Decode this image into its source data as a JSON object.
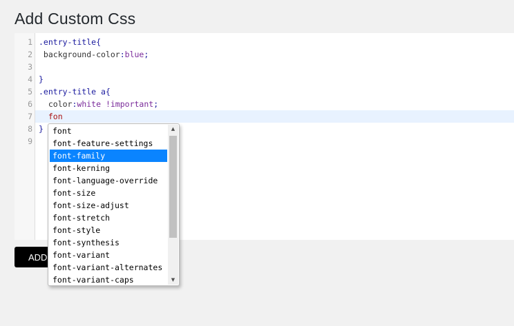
{
  "page": {
    "title": "Add Custom Css"
  },
  "editor": {
    "line_numbers": [
      "1",
      "2",
      "3",
      "4",
      "5",
      "6",
      "7",
      "8",
      "9"
    ],
    "lines": [
      {
        "parts": [
          {
            "text": ".entry-title{",
            "kind": "sel"
          }
        ]
      },
      {
        "parts": [
          {
            "text": " background-color",
            "kind": "prop"
          },
          {
            "text": ":",
            "kind": "sel"
          },
          {
            "text": "blue",
            "kind": "val"
          },
          {
            "text": ";",
            "kind": "sel"
          }
        ]
      },
      {
        "parts": []
      },
      {
        "parts": [
          {
            "text": "}",
            "kind": "sel"
          }
        ]
      },
      {
        "parts": [
          {
            "text": ".entry-title a{",
            "kind": "sel"
          }
        ]
      },
      {
        "parts": [
          {
            "text": "  color",
            "kind": "prop"
          },
          {
            "text": ":",
            "kind": "sel"
          },
          {
            "text": "white !important",
            "kind": "val"
          },
          {
            "text": ";",
            "kind": "sel"
          }
        ]
      },
      {
        "parts": [
          {
            "text": "  fon",
            "kind": "kw"
          }
        ],
        "active": true
      },
      {
        "parts": [
          {
            "text": "}",
            "kind": "sel"
          }
        ]
      },
      {
        "parts": []
      }
    ]
  },
  "add_button": {
    "label": "ADD"
  },
  "autocomplete": {
    "items": [
      "font",
      "font-feature-settings",
      "font-family",
      "font-kerning",
      "font-language-override",
      "font-size",
      "font-size-adjust",
      "font-stretch",
      "font-style",
      "font-synthesis",
      "font-variant",
      "font-variant-alternates",
      "font-variant-caps"
    ],
    "selected_index": 2,
    "scroll_up_icon": "▲",
    "scroll_down_icon": "▼"
  }
}
